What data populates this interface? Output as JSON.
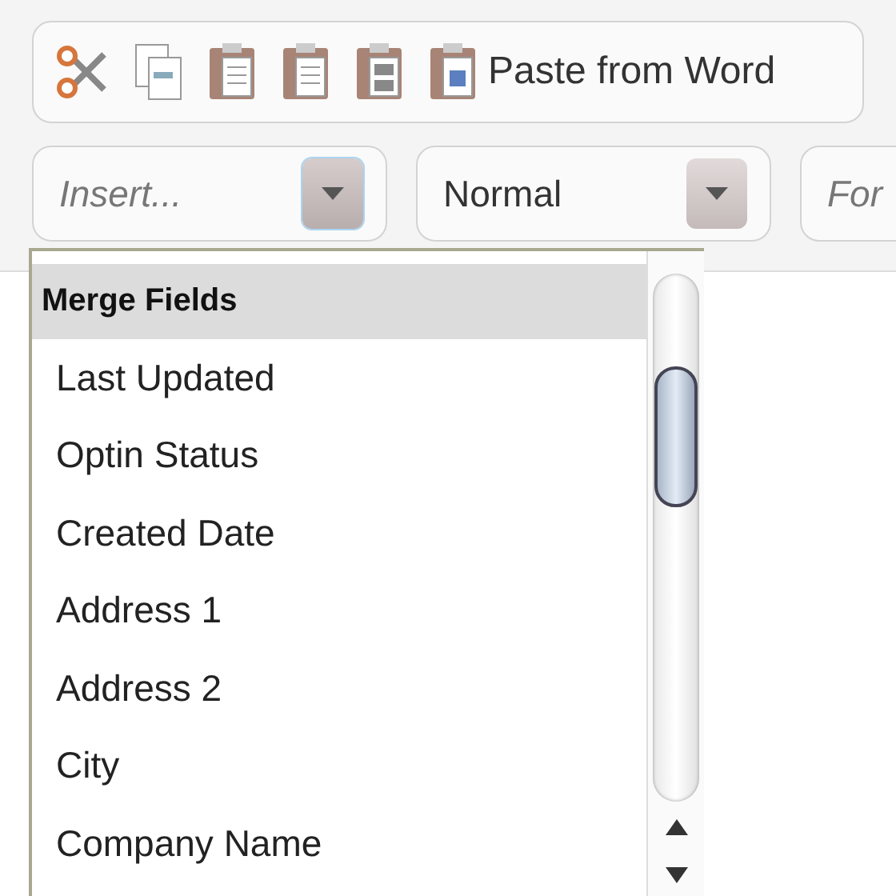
{
  "toolbar": {
    "buttons": [
      {
        "kind": "cut"
      },
      {
        "kind": "copy"
      },
      {
        "kind": "paste"
      },
      {
        "kind": "paste-text"
      },
      {
        "kind": "paste-html"
      },
      {
        "kind": "paste-word",
        "label": "Paste from Word"
      }
    ]
  },
  "combos": [
    {
      "placeholder": "Insert...",
      "expanded": true
    },
    {
      "value": "Normal",
      "expanded": false
    },
    {
      "placeholder": "For"
    }
  ],
  "dropdown": {
    "header": "Merge Fields",
    "items": [
      "Last Updated",
      "Optin Status",
      "Created Date",
      "Address 1",
      "Address 2",
      "City",
      "Company Name"
    ]
  }
}
